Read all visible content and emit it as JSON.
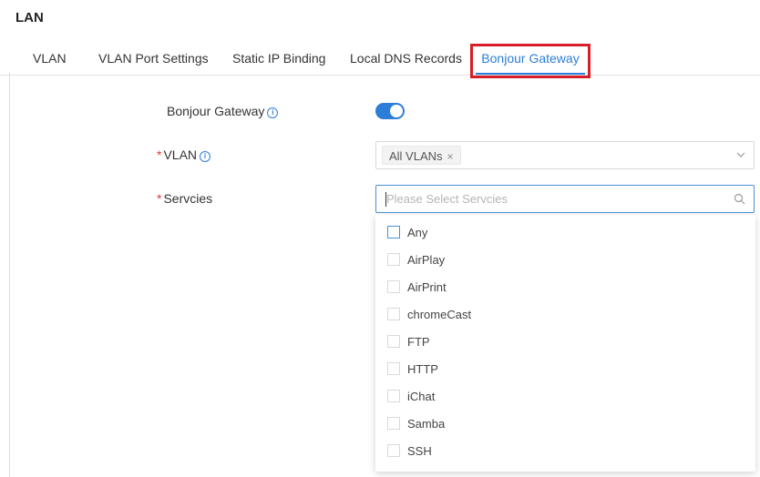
{
  "section_title": "LAN",
  "tabs": [
    {
      "label": "VLAN"
    },
    {
      "label": "VLAN Port Settings"
    },
    {
      "label": "Static IP Binding"
    },
    {
      "label": "Local DNS Records"
    },
    {
      "label": "Bonjour Gateway",
      "active": true
    }
  ],
  "form": {
    "bonjour_gateway": {
      "label": "Bonjour Gateway",
      "enabled": true
    },
    "vlan": {
      "label": "VLAN",
      "required": true,
      "selected_tag": "All VLANs"
    },
    "services": {
      "label": "Servcies",
      "required": true,
      "placeholder": "Please Select Servcies",
      "options": [
        {
          "label": "Any",
          "checked": false
        },
        {
          "label": "AirPlay",
          "checked": false
        },
        {
          "label": "AirPrint",
          "checked": false
        },
        {
          "label": "chromeCast",
          "checked": false
        },
        {
          "label": "FTP",
          "checked": false
        },
        {
          "label": "HTTP",
          "checked": false
        },
        {
          "label": "iChat",
          "checked": false
        },
        {
          "label": "Samba",
          "checked": false
        },
        {
          "label": "SSH",
          "checked": false
        }
      ]
    }
  },
  "icons": {
    "info": "info-icon",
    "tag_close": "close-icon",
    "select_arrow": "chevron-down-icon",
    "search": "search-icon"
  },
  "colors": {
    "accent": "#2d7ed8",
    "highlight_box": "#d81e28",
    "required": "#e53935"
  },
  "glyphs": {
    "info": "i",
    "close": "×",
    "required": "*"
  }
}
